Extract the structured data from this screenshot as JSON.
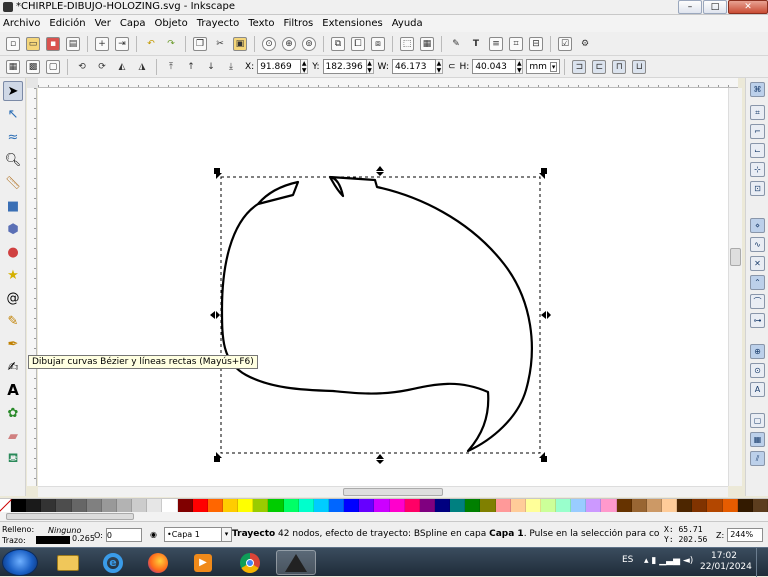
{
  "window": {
    "title": "*CHIRPLE-DIBUJO-HOLOZING.svg - Inkscape",
    "minimize": "–",
    "maximize": "□",
    "close": "✕"
  },
  "menu": [
    "Archivo",
    "Edición",
    "Ver",
    "Capa",
    "Objeto",
    "Trayecto",
    "Texto",
    "Filtros",
    "Extensiones",
    "Ayuda"
  ],
  "toolbar_main": [
    "new",
    "open",
    "save",
    "print",
    "import",
    "export",
    "undo",
    "redo",
    "copy",
    "cut",
    "paste",
    "zoom-selection",
    "zoom-drawing",
    "zoom-page",
    "duplicate",
    "clone",
    "unlink-clone",
    "group",
    "ungroup",
    "fill-stroke",
    "text-font",
    "layers",
    "xml-editor",
    "align",
    "preferences",
    "document-properties"
  ],
  "tool_controls": {
    "x_label": "X:",
    "x_value": "91.869",
    "y_label": "Y:",
    "y_value": "182.396",
    "w_label": "W:",
    "w_value": "46.173",
    "h_label": "H:",
    "h_value": "40.043",
    "unit": "mm"
  },
  "left_tools": {
    "active": "pen",
    "items": [
      "select",
      "node",
      "tweak",
      "zoom",
      "measure",
      "rectangle",
      "3d-box",
      "ellipse",
      "star",
      "spiral",
      "pencil",
      "pen",
      "calligraphy",
      "text",
      "spray",
      "eraser",
      "paint-bucket"
    ]
  },
  "tooltip": "Dibujar curvas Bézier y líneas rectas (Mayús+F6)",
  "palette": [
    "#000000",
    "#1a1a1a",
    "#333333",
    "#4d4d4d",
    "#666666",
    "#808080",
    "#999999",
    "#b3b3b3",
    "#cccccc",
    "#e6e6e6",
    "#ffffff",
    "#800000",
    "#ff0000",
    "#ff6600",
    "#ffcc00",
    "#ffff00",
    "#99cc00",
    "#00cc00",
    "#00ff66",
    "#00ffcc",
    "#00ccff",
    "#0066ff",
    "#0000ff",
    "#6600ff",
    "#cc00ff",
    "#ff00cc",
    "#ff0066",
    "#800080",
    "#000080",
    "#008080",
    "#008000",
    "#808000",
    "#ff9999",
    "#ffcc99",
    "#ffff99",
    "#ccff99",
    "#99ffcc",
    "#99ccff",
    "#cc99ff",
    "#ff99cc",
    "#663300",
    "#996633",
    "#cc9966",
    "#ffcc99",
    "#4d2600",
    "#803300",
    "#b34700",
    "#e65c00",
    "#331a00",
    "#5c3d1e"
  ],
  "status": {
    "fill_label": "Relleno:",
    "fill_value": "Ninguno",
    "stroke_label": "Trazo:",
    "stroke_width": "0.265",
    "opacity_label": "O:",
    "opacity_value": "0",
    "layer": "•Capa 1",
    "message_bold": "Trayecto",
    "message": " 42 nodos, efecto de trayecto: BSpline en capa ",
    "message_bold2": "Capa 1",
    "message_tail": ". Pulse en la selección para conmutar los tira...",
    "x_label": "X:",
    "x_coord": "65.71",
    "y_label": "Y:",
    "y_coord": "202.56",
    "zoom_label": "Z:",
    "zoom": "244%"
  },
  "taskbar": {
    "apps": [
      "explorer",
      "internet-explorer",
      "firefox",
      "media-player",
      "chrome",
      "inkscape"
    ],
    "active": "inkscape",
    "language": "ES",
    "time": "17:02",
    "date": "22/01/2024"
  },
  "colors": {
    "selection_dash": "#000000",
    "stroke": "#000000",
    "taskbar": "#25323f"
  }
}
